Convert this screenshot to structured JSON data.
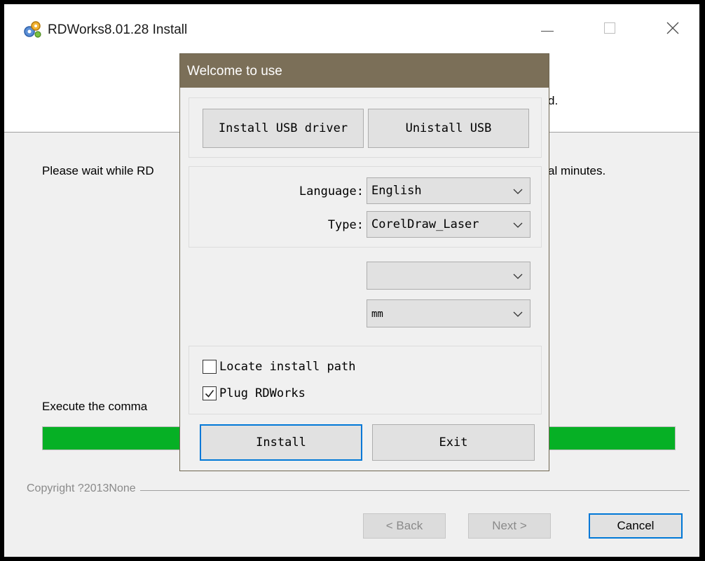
{
  "window": {
    "title": "RDWorks8.01.28 Install",
    "header_text": "d.",
    "wait_text": "Please wait while RD",
    "wait_text_tail": "al minutes.",
    "execute_text": "Execute the comma",
    "progress_percent": 100,
    "copyright": "Copyright ?2013None",
    "back_label": "< Back",
    "next_label": "Next >",
    "cancel_label": "Cancel",
    "progress_color": "#06b025",
    "app_icon": "installer-gears-icon"
  },
  "dialog": {
    "title": "Welcome to use",
    "title_bar_color": "#7b6f58",
    "install_usb_label": "Install USB driver",
    "uninstall_usb_label": "Unistall USB",
    "language_label": "Language:",
    "language_value": "English",
    "type_label": "Type:",
    "type_value": "CorelDraw_Laser",
    "empty_combo_value": "",
    "unit_value": "mm",
    "locate_label": "Locate install path",
    "locate_checked": false,
    "plug_label": "Plug RDWorks",
    "plug_checked": true,
    "install_label": "Install",
    "exit_label": "Exit"
  }
}
